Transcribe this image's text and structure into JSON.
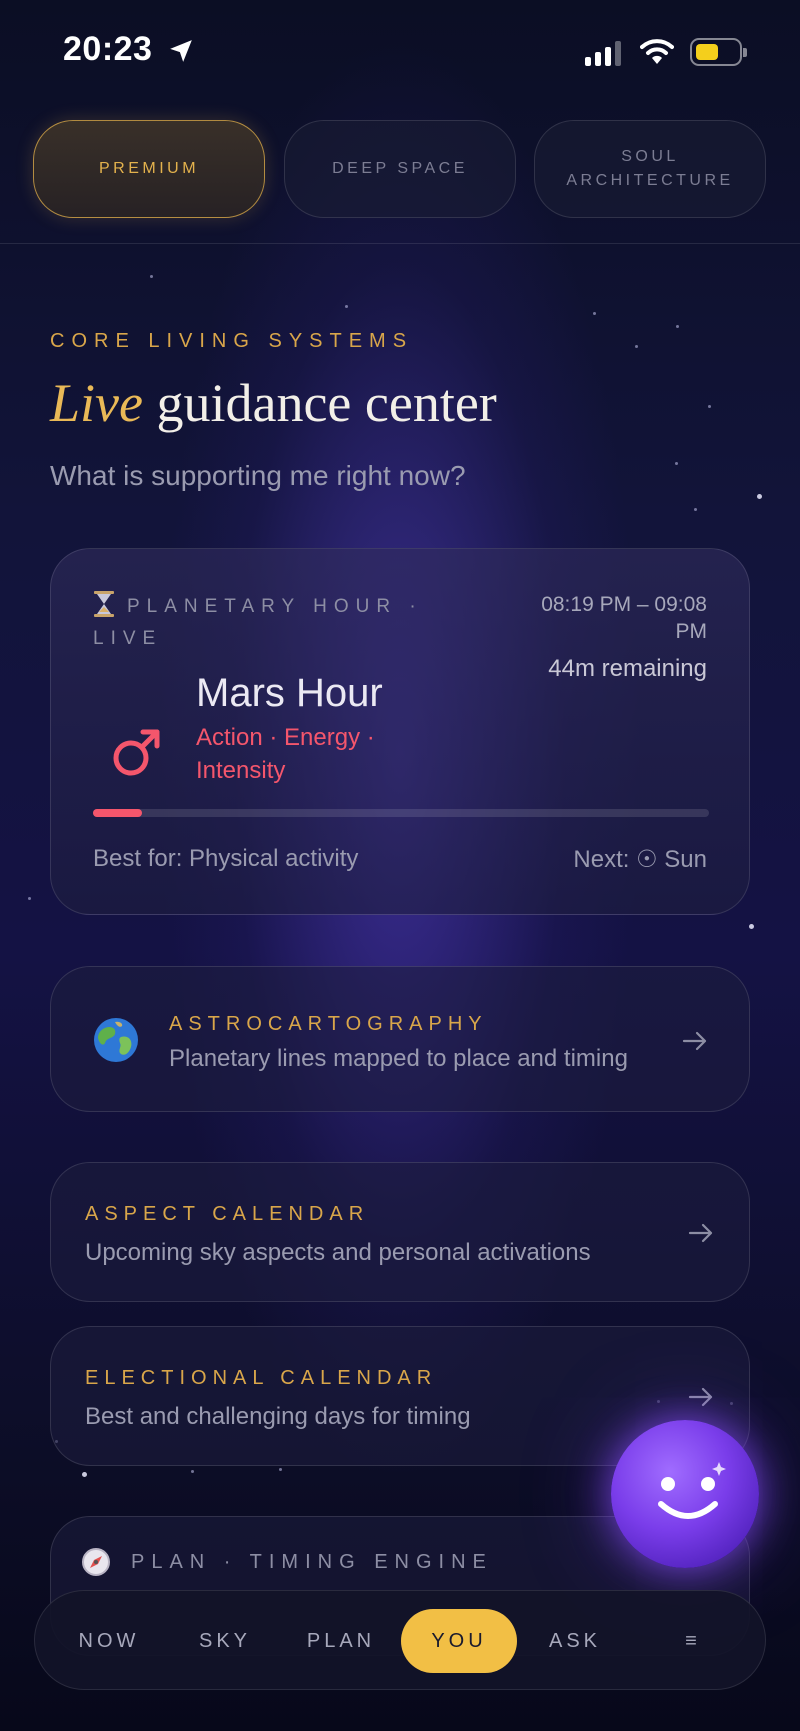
{
  "status_bar": {
    "time": "20:23"
  },
  "top_tabs": [
    {
      "label": "PREMIUM",
      "active": true
    },
    {
      "label": "DEEP SPACE",
      "active": false
    },
    {
      "label": "SOUL ARCHITECTURE",
      "active": false
    }
  ],
  "hero": {
    "eyebrow": "CORE LIVING SYSTEMS",
    "title_emphasis": "Live",
    "title_rest": " guidance center",
    "subtitle": "What is supporting me right now?"
  },
  "planetary_hour": {
    "label": "PLANETARY HOUR · LIVE",
    "time_range": "08:19 PM – 09:08 PM",
    "remaining": "44m remaining",
    "name": "Mars Hour",
    "keywords": "Action · Energy · Intensity",
    "progress": 0.08,
    "best_for": "Best for: Physical activity",
    "next": "Next: ☉ Sun",
    "accent_color": "#f4566c"
  },
  "cards": {
    "astrocartography": {
      "title": "ASTROCARTOGRAPHY",
      "description": "Planetary lines mapped to place and timing"
    },
    "aspect_calendar": {
      "title": "ASPECT CALENDAR",
      "description": "Upcoming sky aspects and personal activations"
    },
    "electional_calendar": {
      "title": "ELECTIONAL CALENDAR",
      "description": "Best and challenging days for timing"
    },
    "plan_timing": {
      "title": "PLAN · TIMING ENGINE"
    }
  },
  "bottom_nav": [
    {
      "label": "NOW",
      "active": false
    },
    {
      "label": "SKY",
      "active": false
    },
    {
      "label": "PLAN",
      "active": false
    },
    {
      "label": "YOU",
      "active": true
    },
    {
      "label": "ASK",
      "active": false
    },
    {
      "label": "≡",
      "active": false
    }
  ],
  "colors": {
    "gold": "#d9a64a",
    "active_nav": "#f2bf45",
    "orb": "#7a3dea"
  }
}
